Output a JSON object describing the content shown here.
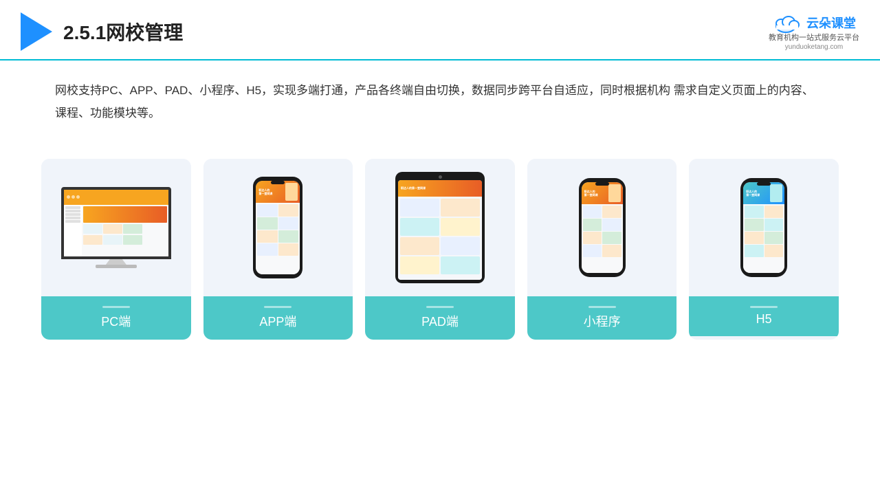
{
  "header": {
    "title": "2.5.1网校管理",
    "brand": {
      "name": "云朵课堂",
      "url": "yunduoketang.com",
      "tagline": "教育机构一站\n式服务云平台"
    }
  },
  "description": "网校支持PC、APP、PAD、小程序、H5，实现多端打通，产品各终端自由切换，数据同步跨平台自适应，同时根据机构\n需求自定义页面上的内容、课程、功能模块等。",
  "cards": [
    {
      "id": "pc",
      "label": "PC端"
    },
    {
      "id": "app",
      "label": "APP端"
    },
    {
      "id": "pad",
      "label": "PAD端"
    },
    {
      "id": "miniprogram",
      "label": "小程序"
    },
    {
      "id": "h5",
      "label": "H5"
    }
  ],
  "colors": {
    "accent": "#4dc8c8",
    "header_border": "#00bcd4",
    "title": "#222222",
    "text": "#333333",
    "brand_blue": "#1e90ff"
  }
}
